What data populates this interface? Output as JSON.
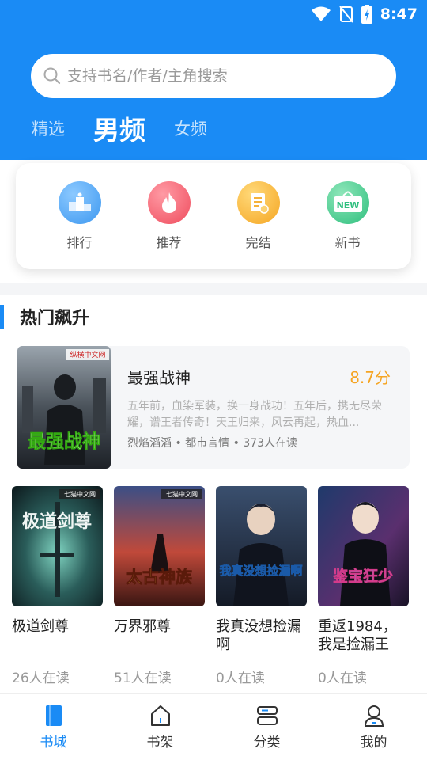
{
  "status": {
    "time": "8:47"
  },
  "search": {
    "placeholder": "支持书名/作者/主角搜索"
  },
  "tabs": [
    {
      "label": "精选"
    },
    {
      "label": "男频"
    },
    {
      "label": "女频"
    }
  ],
  "categories": [
    {
      "label": "排行",
      "icon": "ranking-icon",
      "color": "#4aa6f5"
    },
    {
      "label": "推荐",
      "icon": "fire-icon",
      "color": "#f25e6b"
    },
    {
      "label": "完结",
      "icon": "document-icon",
      "color": "#f9b53b"
    },
    {
      "label": "新书",
      "icon": "new-sign-icon",
      "color": "#3ec88a",
      "badge": "NEW"
    }
  ],
  "hot_section": {
    "title": "热门飙升"
  },
  "feature_book": {
    "title": "最强战神",
    "score": "8.7分",
    "description": "五年前，血染军装，换一身战功！五年后，携无尽荣耀，谱王者传奇！天王归来，风云再起，热血...",
    "meta": "烈焰滔滔 • 都市言情 • 373人在读",
    "cover_text": "最强战神",
    "cover_publisher": "纵横中文网"
  },
  "books": [
    {
      "title": "极道剑尊",
      "readers": "26人在读",
      "cover_text": "极道剑尊",
      "cover_publisher": "七猫中文网"
    },
    {
      "title": "万界邪尊",
      "readers": "51人在读",
      "cover_text": "太古神族",
      "cover_publisher": "七猫中文网"
    },
    {
      "title": "我真没想捡漏啊",
      "readers": "0人在读",
      "cover_text": "我真没想捡漏啊",
      "cover_publisher": ""
    },
    {
      "title": "重返1984，我是捡漏王",
      "readers": "0人在读",
      "cover_text": "鉴宝狂少",
      "cover_publisher": ""
    }
  ],
  "bottom_nav": [
    {
      "label": "书城",
      "active": true
    },
    {
      "label": "书架"
    },
    {
      "label": "分类"
    },
    {
      "label": "我的"
    }
  ],
  "colors": {
    "primary": "#1a8bf5",
    "score": "#f5a524"
  }
}
